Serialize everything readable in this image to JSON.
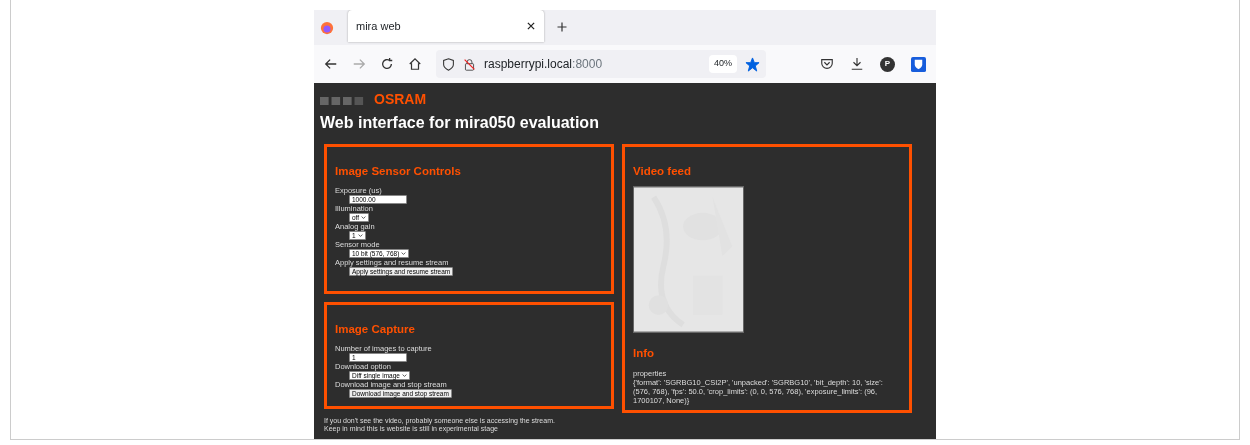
{
  "browser": {
    "tab_title": "mira web",
    "url_host": "raspberrypi.local",
    "url_port": ":8000",
    "zoom": "40%",
    "bookmarked": true,
    "profile_initial": "P"
  },
  "page": {
    "logo_osram": "OSRAM",
    "title": "Web interface for mira050 evaluation",
    "sensor_controls": {
      "heading": "Image Sensor Controls",
      "fields": [
        {
          "kind": "number",
          "label": "Exposure (us)",
          "value": "1000.00"
        },
        {
          "kind": "select",
          "label": "Illumination",
          "value": "off"
        },
        {
          "kind": "select",
          "label": "Analog gain",
          "value": "1"
        },
        {
          "kind": "select",
          "label": "Sensor mode",
          "value": "10 bit (576, 768)"
        },
        {
          "kind": "button",
          "label": "Apply settings and resume stream",
          "value": "Apply settings and resume stream"
        }
      ]
    },
    "capture": {
      "heading": "Image Capture",
      "fields": [
        {
          "kind": "number",
          "label": "Number of images to capture",
          "value": "1"
        },
        {
          "kind": "select",
          "label": "Download option",
          "value": "Diff single image"
        },
        {
          "kind": "button",
          "label": "Download image and stop stream",
          "value": "Download image and stop stream"
        }
      ]
    },
    "video": {
      "heading": "Video feed"
    },
    "info": {
      "heading": "Info",
      "label": "properties",
      "text": "{'format': 'SGRBG10_CSI2P', 'unpacked': 'SGRBG10', 'bit_depth': 10, 'size': (576, 768), 'fps': 50.0, 'crop_limits': (0, 0, 576, 768), 'exposure_limits': (96, 1700107, None)}"
    },
    "notes": [
      "If you don't see the video, probably someone else is accessing the stream.",
      "Keep in mind this is website is still in experimental stage"
    ]
  }
}
